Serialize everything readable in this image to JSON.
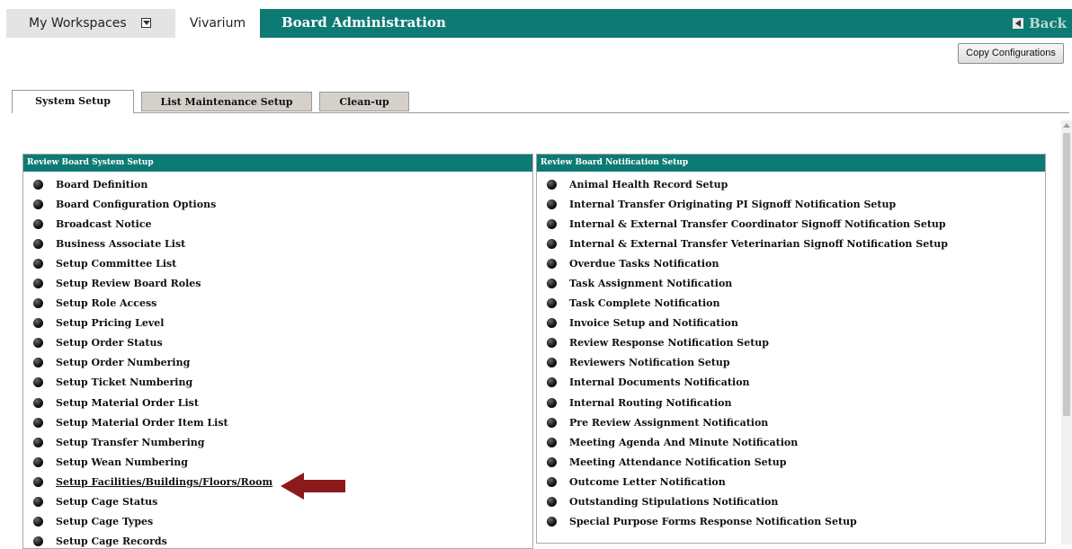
{
  "nav": {
    "workspaces_label": "My Workspaces",
    "vivarium_label": "Vivarium",
    "title": "Board Administration",
    "back_label": "Back"
  },
  "toolbar": {
    "copy_label": "Copy Configurations"
  },
  "tabs": [
    {
      "label": "System Setup",
      "active": true
    },
    {
      "label": "List Maintenance Setup",
      "active": false
    },
    {
      "label": "Clean-up",
      "active": false
    }
  ],
  "left_panel": {
    "title": "Review Board System Setup",
    "items": [
      "Board Definition",
      "Board Configuration Options",
      "Broadcast Notice",
      "Business Associate List",
      "Setup Committee List",
      "Setup Review Board Roles",
      "Setup Role Access",
      "Setup Pricing Level",
      "Setup Order Status",
      "Setup Order Numbering",
      "Setup Ticket Numbering",
      "Setup Material Order List",
      "Setup Material Order Item List",
      "Setup Transfer Numbering",
      "Setup Wean Numbering",
      "Setup Facilities/Buildings/Floors/Room",
      "Setup Cage Status",
      "Setup Cage Types",
      "Setup Cage Records"
    ]
  },
  "right_panel": {
    "title": "Review Board  Notification Setup",
    "items": [
      "Animal Health Record Setup",
      "Internal Transfer Originating PI Signoff Notification Setup",
      "Internal & External Transfer Coordinator Signoff Notification Setup",
      "Internal & External Transfer Veterinarian Signoff Notification Setup",
      "Overdue Tasks Notification",
      "Task Assignment Notification",
      "Task Complete Notification",
      "Invoice Setup and Notification",
      "Review Response Notification Setup",
      "Reviewers Notification Setup",
      "Internal Documents Notification",
      "Internal Routing Notification",
      "Pre Review Assignment Notification",
      "Meeting Agenda And Minute Notification",
      "Meeting Attendance Notification Setup",
      "Outcome Letter Notification",
      "Outstanding Stipulations Notification",
      "Special Purpose Forms Response Notification Setup"
    ]
  },
  "colors": {
    "header_teal": "#0e7a74",
    "arrow": "#8b1a1a",
    "tab_inactive": "#d6d0cb"
  }
}
